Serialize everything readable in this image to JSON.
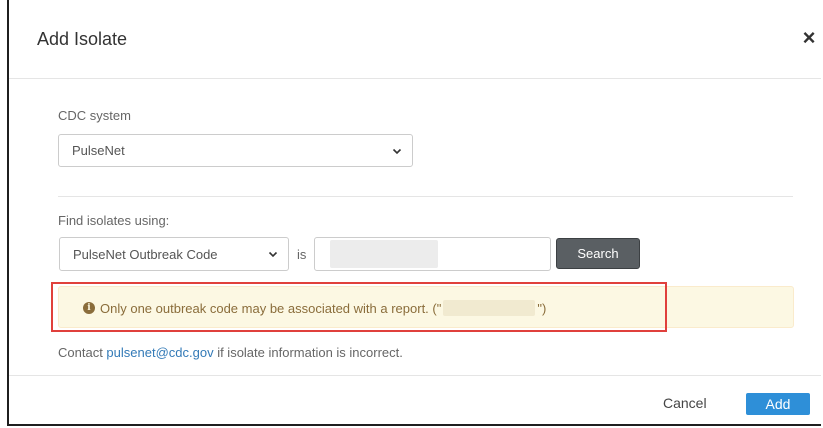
{
  "dialog": {
    "title": "Add Isolate",
    "close_label": "×"
  },
  "cdc_system": {
    "label": "CDC system",
    "selected": "PulseNet"
  },
  "find": {
    "label": "Find isolates using:",
    "field_selected": "PulseNet Outbreak Code",
    "operator": "is",
    "value": "",
    "search_label": "Search"
  },
  "warning": {
    "icon": "info-circle-icon",
    "text_before": "Only one outbreak code may be associated with a report. (\"",
    "text_after": "\")",
    "color": "#8a6d3b",
    "background": "#fcf8e3"
  },
  "contact": {
    "prefix": "Contact ",
    "email": "pulsenet@cdc.gov",
    "suffix": " if isolate information is incorrect."
  },
  "footer": {
    "cancel_label": "Cancel",
    "add_label": "Add",
    "add_color": "#2e8fd8"
  },
  "highlight_color": "#e0403c"
}
